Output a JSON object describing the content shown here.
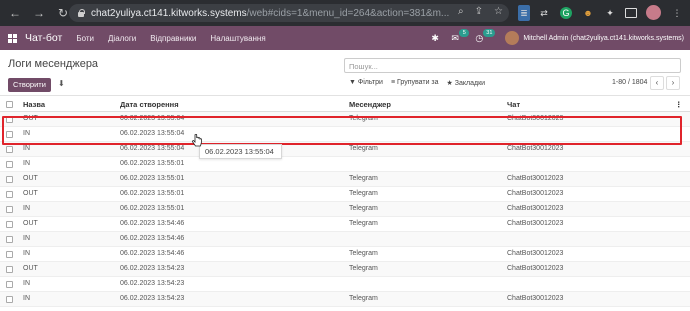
{
  "browser": {
    "url_host": "chat2yuliya.ct141.kitworks.systems",
    "url_path": "/web#cids=1&menu_id=264&action=381&m..."
  },
  "app": {
    "title": "Чат-бот",
    "menus": [
      "Боти",
      "Діалоги",
      "Відправники",
      "Налаштування"
    ],
    "badge_messages": "5",
    "badge_activity": "31",
    "user": "Mitchell Admin (chat2yuliya.ct141.kitworks.systems)"
  },
  "control_panel": {
    "breadcrumb": "Логи месенджера",
    "create_label": "Створити",
    "search_placeholder": "Пошук...",
    "filters_label": "Фільтри",
    "group_by_label": "Групувати за",
    "favorites_label": "Закладки",
    "pager": "1-80 / 1804"
  },
  "table": {
    "headers": {
      "name": "Назва",
      "created": "Дата створення",
      "messenger": "Месенджер",
      "chat": "Чат"
    },
    "rows": [
      {
        "name": "OUT",
        "created": "06.02.2023 13:55:04",
        "messenger": "Telegram",
        "chat": "ChatBot30012023"
      },
      {
        "name": "IN",
        "created": "06.02.2023 13:55:04",
        "messenger": "",
        "chat": ""
      },
      {
        "name": "IN",
        "created": "06.02.2023 13:55:04",
        "messenger": "Telegram",
        "chat": "ChatBot30012023"
      },
      {
        "name": "IN",
        "created": "06.02.2023 13:55:01",
        "messenger": "",
        "chat": ""
      },
      {
        "name": "OUT",
        "created": "06.02.2023 13:55:01",
        "messenger": "Telegram",
        "chat": "ChatBot30012023"
      },
      {
        "name": "OUT",
        "created": "06.02.2023 13:55:01",
        "messenger": "Telegram",
        "chat": "ChatBot30012023"
      },
      {
        "name": "IN",
        "created": "06.02.2023 13:55:01",
        "messenger": "Telegram",
        "chat": "ChatBot30012023"
      },
      {
        "name": "OUT",
        "created": "06.02.2023 13:54:46",
        "messenger": "Telegram",
        "chat": "ChatBot30012023"
      },
      {
        "name": "IN",
        "created": "06.02.2023 13:54:46",
        "messenger": "",
        "chat": ""
      },
      {
        "name": "IN",
        "created": "06.02.2023 13:54:46",
        "messenger": "Telegram",
        "chat": "ChatBot30012023"
      },
      {
        "name": "OUT",
        "created": "06.02.2023 13:54:23",
        "messenger": "Telegram",
        "chat": "ChatBot30012023"
      },
      {
        "name": "IN",
        "created": "06.02.2023 13:54:23",
        "messenger": "",
        "chat": ""
      },
      {
        "name": "IN",
        "created": "06.02.2023 13:54:23",
        "messenger": "Telegram",
        "chat": "ChatBot30012023"
      }
    ]
  },
  "tooltip": "06.02.2023 13:55:04",
  "colors": {
    "brand": "#714b67",
    "highlight": "#e0242b"
  }
}
